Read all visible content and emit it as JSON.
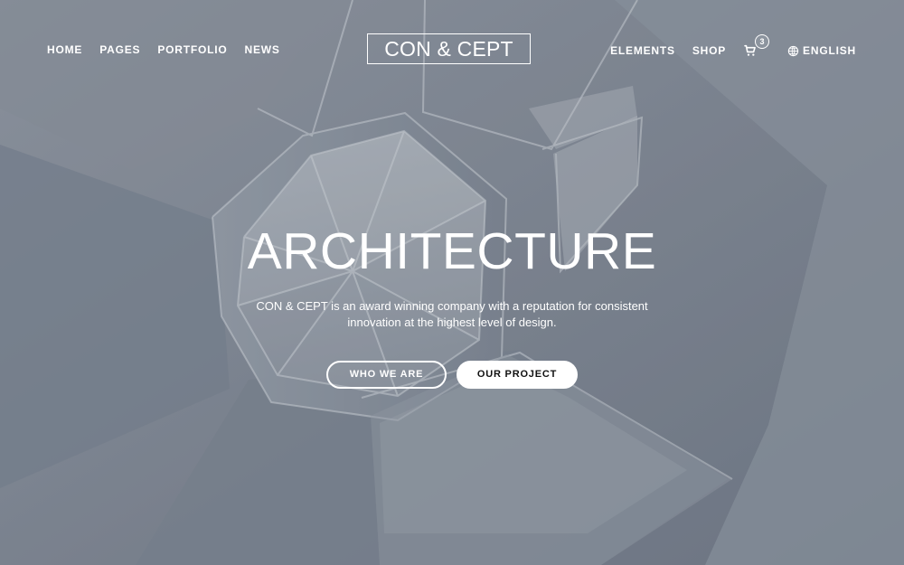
{
  "nav": {
    "left": [
      "HOME",
      "PAGES",
      "PORTFOLIO",
      "NEWS"
    ],
    "right": {
      "elements": "ELEMENTS",
      "shop": "SHOP",
      "cart_count": "3",
      "language": "ENGLISH"
    }
  },
  "logo": {
    "text": "CON & CEPT"
  },
  "hero": {
    "title": "ARCHITECTURE",
    "description_line_1": "CON & CEPT is an award winning company with a reputation for consistent",
    "description_line_2": "innovation at the highest level of design.",
    "primary_button": "WHO WE ARE",
    "secondary_button": "OUR PROJECT"
  },
  "icons": {
    "cart": "shopping-cart-icon",
    "language": "globe-icon"
  },
  "colors": {
    "text": "#ffffff",
    "button_dark_text": "#111111",
    "background": "#7b828f"
  }
}
